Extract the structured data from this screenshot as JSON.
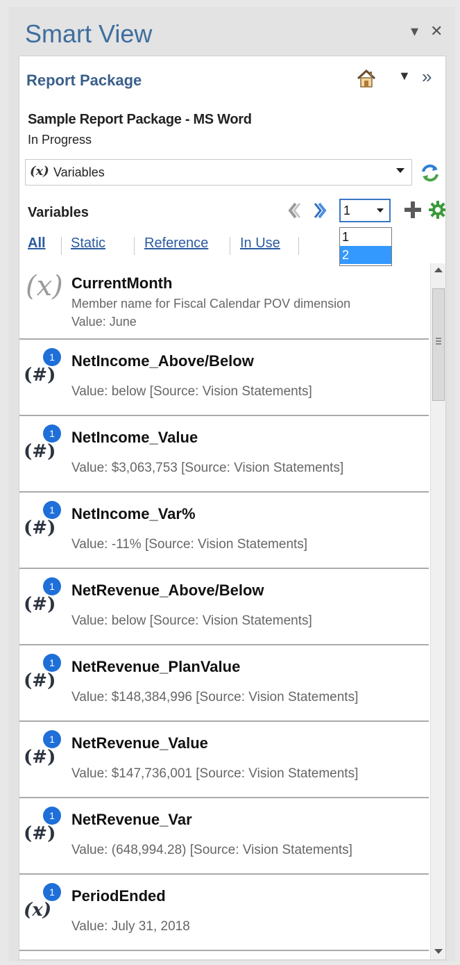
{
  "title": "Smart View",
  "title_controls": {
    "menu": "▾",
    "close": "✕"
  },
  "report_package_link": "Report Package",
  "home_icon": "home-icon",
  "more_icon": "»",
  "package": {
    "name": "Sample Report Package - MS Word",
    "status": "In Progress"
  },
  "selector": {
    "icon": "(x)",
    "value": "Variables"
  },
  "variables_heading": "Variables",
  "page_select": {
    "value": "1",
    "options": [
      "1",
      "2"
    ],
    "highlighted": "2"
  },
  "filters": {
    "all": "All",
    "static": "Static",
    "reference": "Reference",
    "in_use": "In Use"
  },
  "colors": {
    "title": "#3e6e9e",
    "link": "#2a5aa0",
    "badge": "#1e6fd8",
    "add": "#555555",
    "gear": "#3a9a3a"
  },
  "items": [
    {
      "name": "CurrentMonth",
      "desc": "Member name for Fiscal Calendar POV dimension",
      "value": "Value: June",
      "icon": "(x)"
    },
    {
      "name": "NetIncome_Above/Below",
      "value": "Value: below [Source: Vision Statements]",
      "badge": "1",
      "icon": "(#)"
    },
    {
      "name": "NetIncome_Value",
      "value": "Value:  $3,063,753  [Source: Vision Statements]",
      "badge": "1",
      "icon": "(#)"
    },
    {
      "name": "NetIncome_Var%",
      "value": "Value: -11% [Source: Vision Statements]",
      "badge": "1",
      "icon": "(#)"
    },
    {
      "name": "NetRevenue_Above/Below",
      "value": "Value: below [Source: Vision Statements]",
      "badge": "1",
      "icon": "(#)"
    },
    {
      "name": "NetRevenue_PlanValue",
      "value": "Value:  $148,384,996  [Source: Vision Statements]",
      "badge": "1",
      "icon": "(#)"
    },
    {
      "name": "NetRevenue_Value",
      "value": "Value:  $147,736,001  [Source: Vision Statements]",
      "badge": "1",
      "icon": "(#)"
    },
    {
      "name": "NetRevenue_Var",
      "value": "Value:  (648,994.28) [Source: Vision Statements]",
      "badge": "1",
      "icon": "(#)"
    },
    {
      "name": "PeriodEnded",
      "value": "Value: July 31, 2018",
      "badge": "1",
      "icon": "(x)"
    }
  ]
}
